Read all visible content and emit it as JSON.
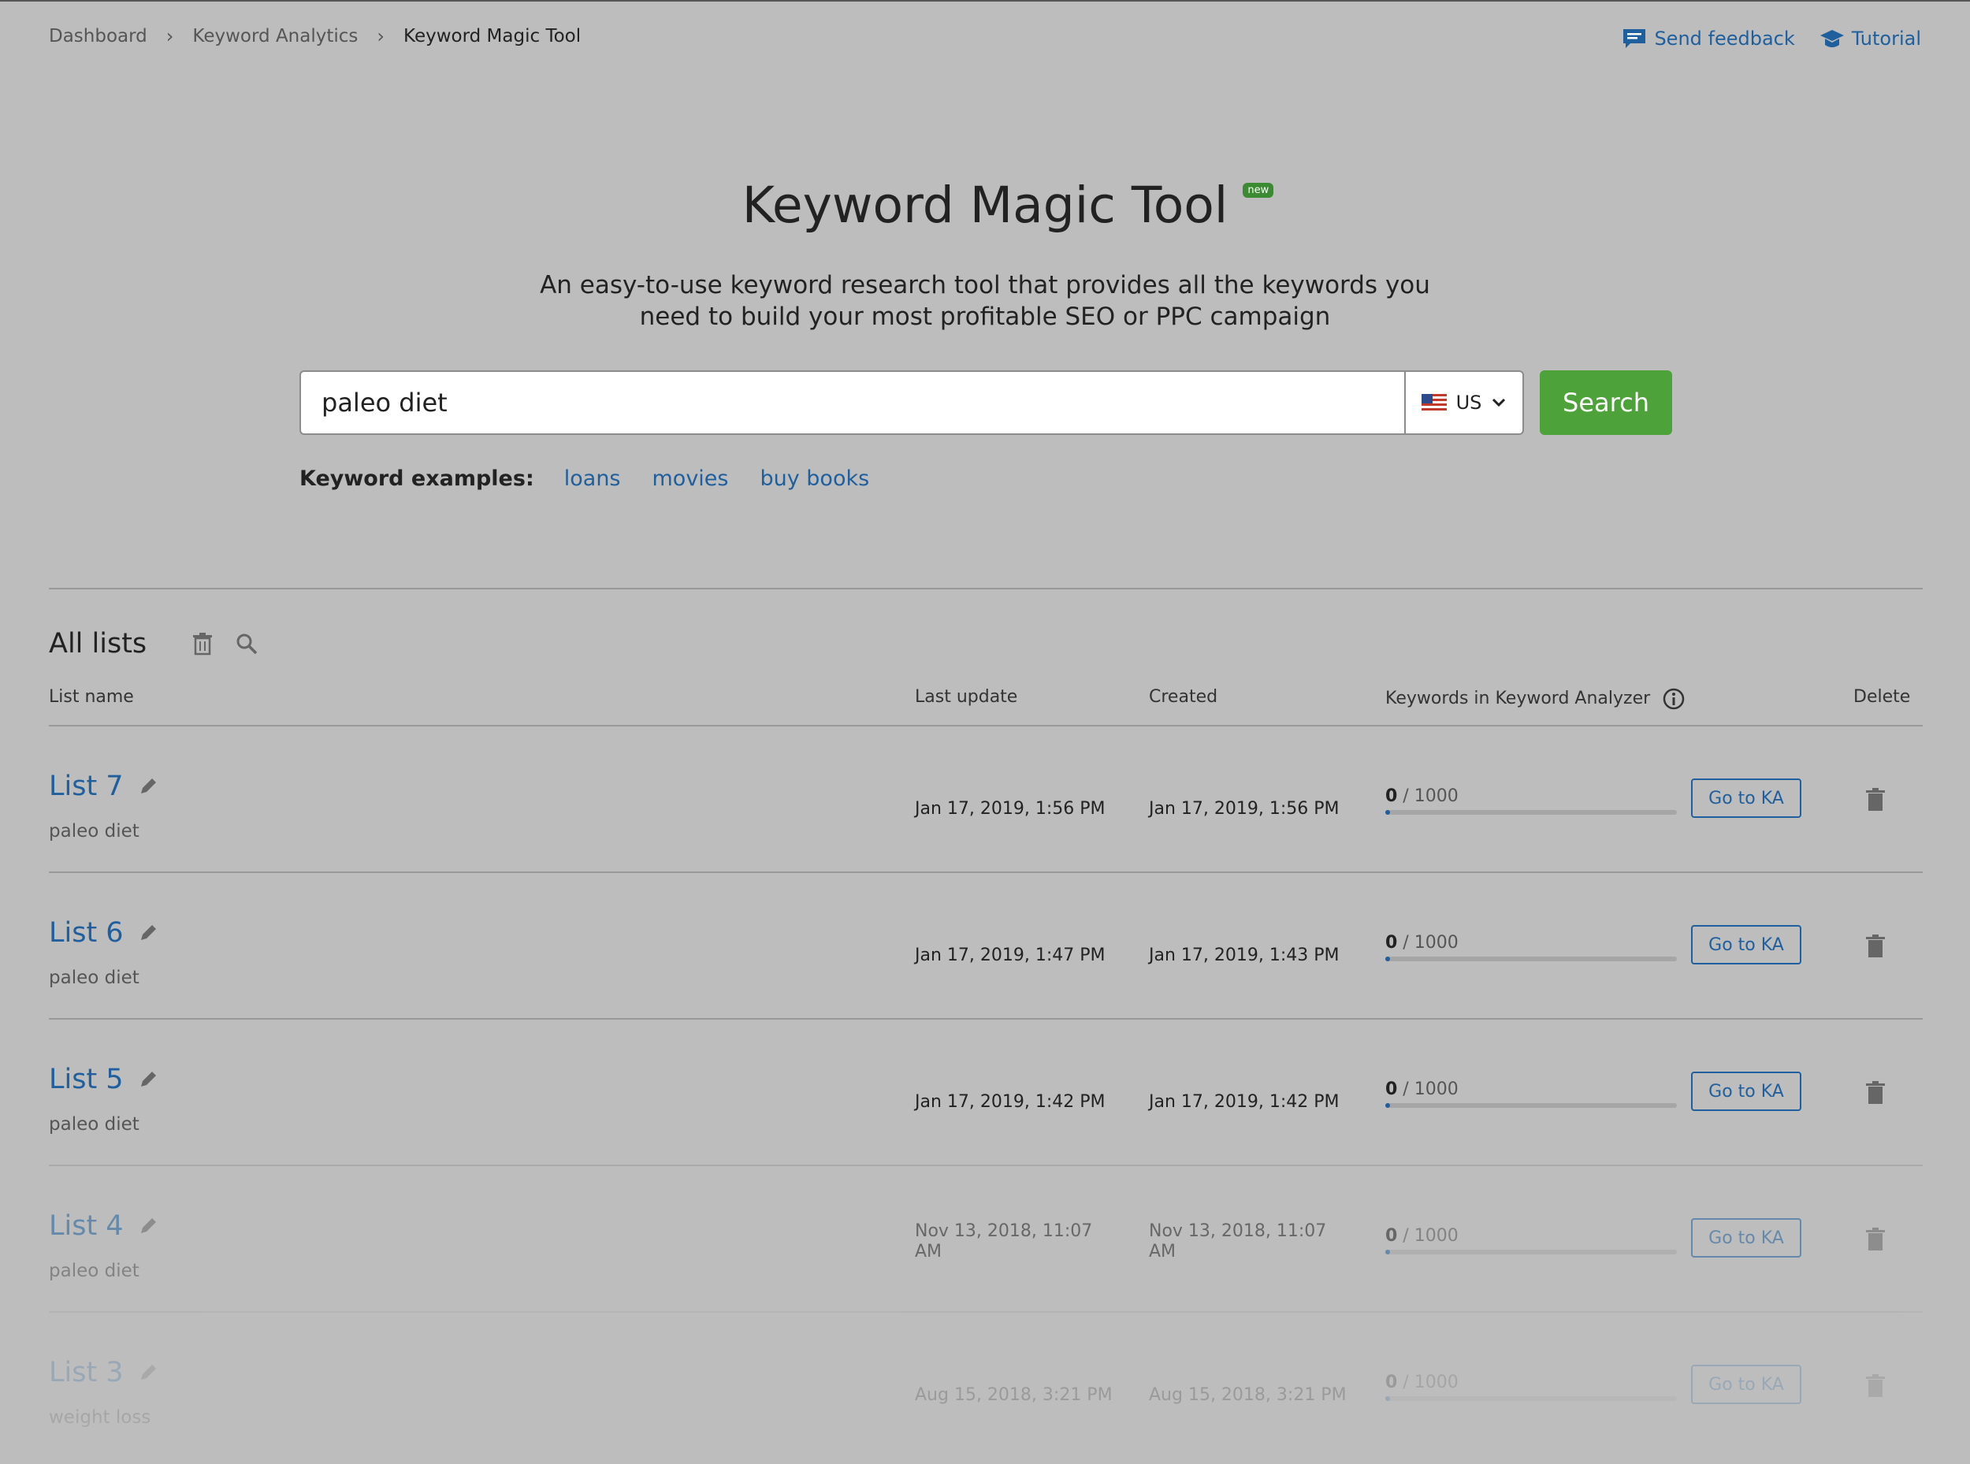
{
  "breadcrumb": [
    "Dashboard",
    "Keyword Analytics",
    "Keyword Magic Tool"
  ],
  "top_links": {
    "feedback": "Send feedback",
    "tutorial": "Tutorial"
  },
  "hero": {
    "title": "Keyword Magic Tool",
    "badge": "new",
    "subtitle_line1": "An easy-to-use keyword research tool that provides all the keywords you",
    "subtitle_line2": "need to build your most profitable SEO or PPC campaign"
  },
  "search": {
    "value": "paleo diet",
    "country": "US",
    "button": "Search"
  },
  "examples": {
    "label": "Keyword examples:",
    "items": [
      "loans",
      "movies",
      "buy books"
    ]
  },
  "lists": {
    "title": "All lists",
    "columns": {
      "name": "List name",
      "last_update": "Last update",
      "created": "Created",
      "keywords": "Keywords in Keyword Analyzer",
      "delete": "Delete"
    },
    "rows": [
      {
        "name": "List 7",
        "keyword": "paleo diet",
        "last_update": "Jan 17, 2019, 1:56 PM",
        "created": "Jan 17, 2019, 1:56 PM",
        "count": "0",
        "limit": "1000",
        "fill": 0.01,
        "action": "Go to KA"
      },
      {
        "name": "List 6",
        "keyword": "paleo diet",
        "last_update": "Jan 17, 2019, 1:47 PM",
        "created": "Jan 17, 2019, 1:43 PM",
        "count": "0",
        "limit": "1000",
        "fill": 0.01,
        "action": "Go to KA"
      },
      {
        "name": "List 5",
        "keyword": "paleo diet",
        "last_update": "Jan 17, 2019, 1:42 PM",
        "created": "Jan 17, 2019, 1:42 PM",
        "count": "0",
        "limit": "1000",
        "fill": 0.01,
        "action": "Go to KA"
      },
      {
        "name": "List 4",
        "keyword": "paleo diet",
        "last_update": "Nov 13, 2018, 11:07 AM",
        "created": "Nov 13, 2018, 11:07 AM",
        "count": "0",
        "limit": "1000",
        "fill": 0.01,
        "action": "Go to KA"
      },
      {
        "name": "List 3",
        "keyword": "weight loss",
        "last_update": "Aug 15, 2018, 3:21 PM",
        "created": "Aug 15, 2018, 3:21 PM",
        "count": "0",
        "limit": "1000",
        "fill": 0.01,
        "action": "Go to KA"
      }
    ]
  },
  "colors": {
    "accent": "#1f5f9e",
    "search_button": "#4da23a",
    "badge": "#3a8b32",
    "background": "#bdbdbd"
  }
}
